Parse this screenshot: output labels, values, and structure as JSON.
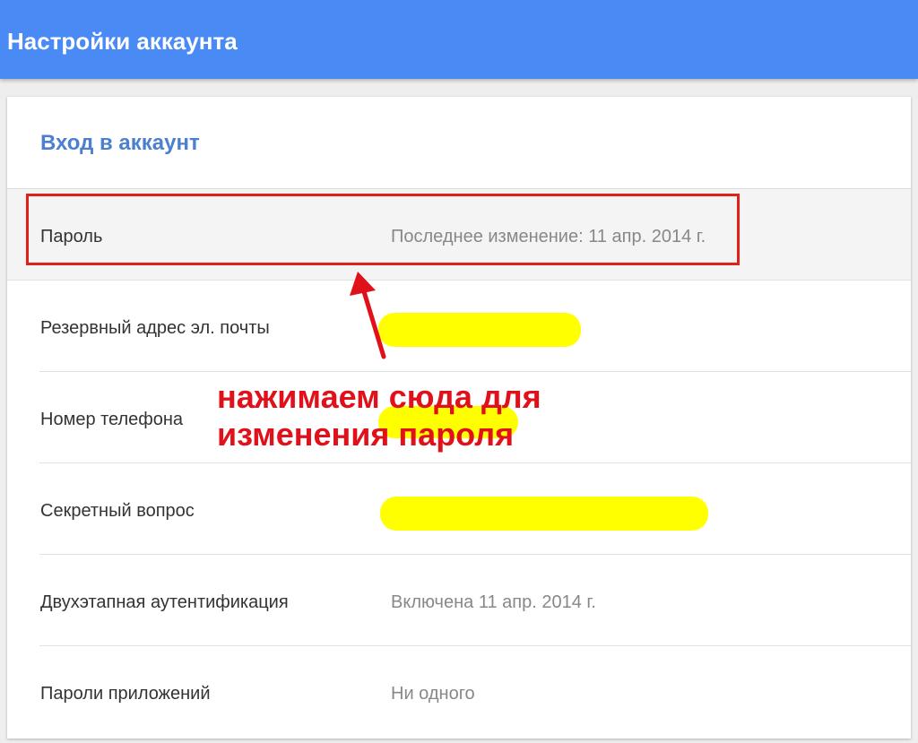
{
  "header": {
    "title": "Настройки аккаунта"
  },
  "card": {
    "title": "Вход в аккаунт",
    "rows": [
      {
        "label": "Пароль",
        "value": "Последнее изменение: 11 апр. 2014 г."
      },
      {
        "label": "Резервный адрес эл. почты",
        "value": ""
      },
      {
        "label": "Номер телефона",
        "value": ""
      },
      {
        "label": "Секретный вопрос",
        "value": ""
      },
      {
        "label": "Двухэтапная аутентификация",
        "value": "Включена 11 апр. 2014 г."
      },
      {
        "label": "Пароли приложений",
        "value": "Ни одного"
      }
    ]
  },
  "annotation": {
    "line1": "нажимаем сюда для",
    "line2": "изменения пароля"
  },
  "colors": {
    "header_bg": "#4a8af4",
    "card_title": "#4d7fd0",
    "annotation_red": "#e0111b",
    "redaction_yellow": "#ffff00"
  }
}
